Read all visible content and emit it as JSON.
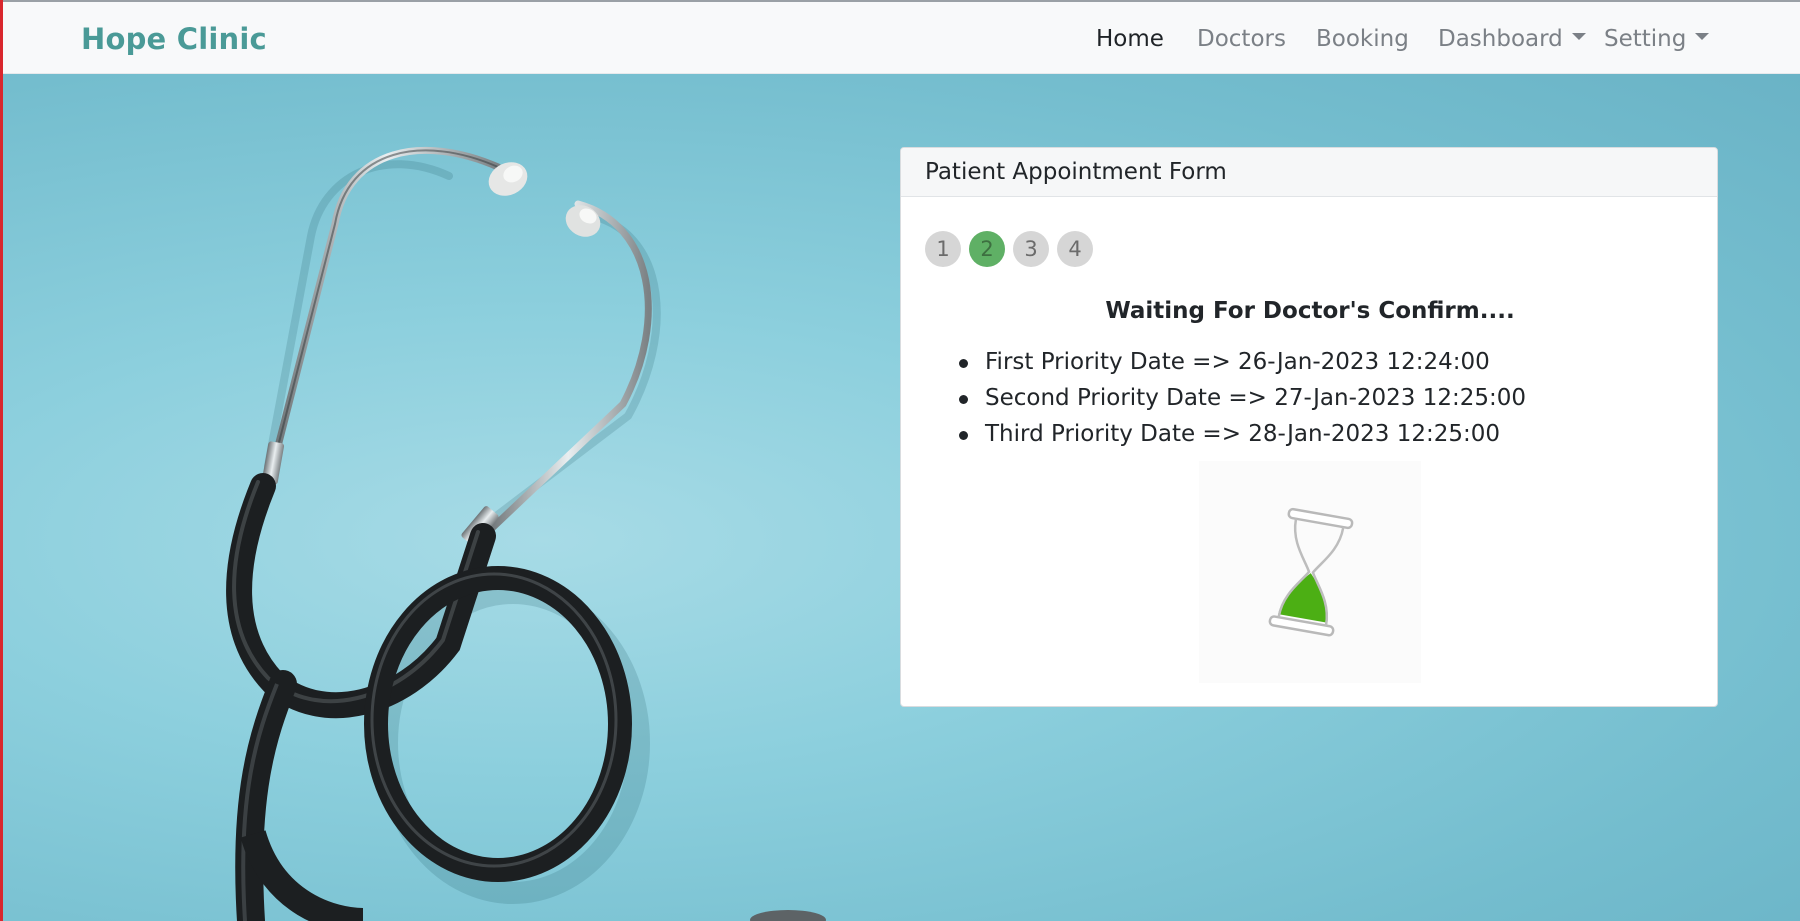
{
  "navbar": {
    "brand": "Hope Clinic",
    "links": {
      "home": "Home",
      "doctors": "Doctors",
      "booking": "Booking",
      "dashboard": "Dashboard",
      "setting": "Setting"
    },
    "active": "Home"
  },
  "card": {
    "header": "Patient Appointment Form",
    "steps": [
      "1",
      "2",
      "3",
      "4"
    ],
    "current_step": 2,
    "status_title": "Waiting For Doctor's Confirm....",
    "priority_dates": [
      "First Priority Date => 26-Jan-2023 12:24:00",
      "Second Priority Date => 27-Jan-2023 12:25:00",
      "Third Priority Date => 28-Jan-2023 12:25:00"
    ]
  },
  "icons": {
    "loader": "hourglass-icon",
    "background": "stethoscope-image"
  },
  "colors": {
    "brand": "#4a9a97",
    "active_step": "#5fb065",
    "inactive_step": "#d6d6d6",
    "hourglass_sand": "#4caf14",
    "frame_left": "#d9262d",
    "background": "#7fc4d3"
  }
}
